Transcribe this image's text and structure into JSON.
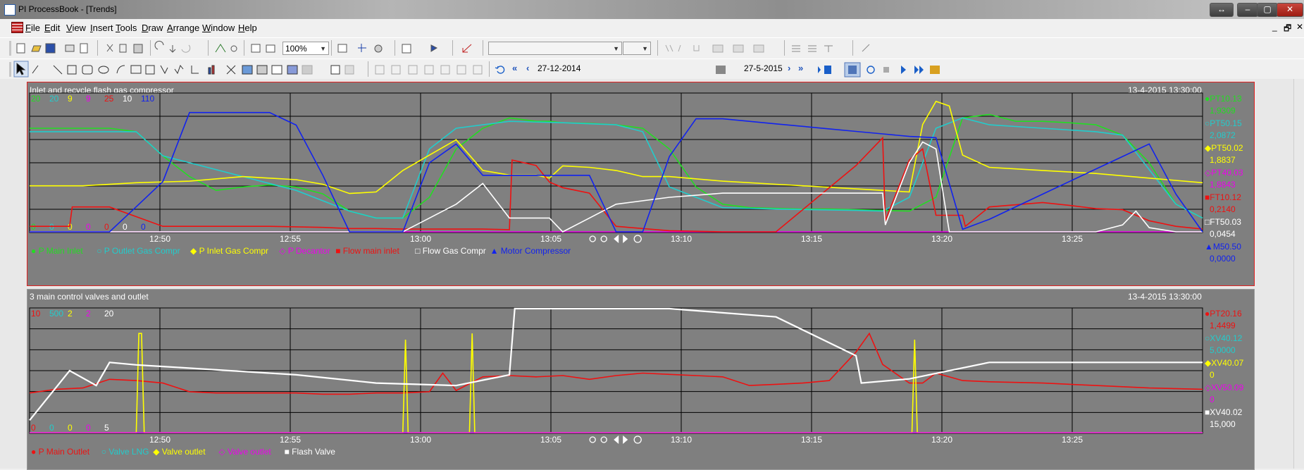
{
  "window": {
    "title": "PI ProcessBook - [Trends]"
  },
  "menu": [
    {
      "label": "File",
      "u": "F",
      "rest": "ile"
    },
    {
      "label": "Edit",
      "u": "E",
      "rest": "dit"
    },
    {
      "label": "View",
      "u": "V",
      "rest": "iew"
    },
    {
      "label": "Insert",
      "u": "I",
      "rest": "nsert"
    },
    {
      "label": "Tools",
      "u": "T",
      "rest": "ools"
    },
    {
      "label": "Draw",
      "u": "D",
      "rest": "raw"
    },
    {
      "label": "Arrange",
      "u": "A",
      "rest": "rrange"
    },
    {
      "label": "Window",
      "u": "W",
      "rest": "indow"
    },
    {
      "label": "Help",
      "u": "H",
      "rest": "elp"
    }
  ],
  "toolbar": {
    "zoom": "100%"
  },
  "timebar": {
    "start": "27-12-2014",
    "end": "27-5-2015"
  },
  "trends": [
    {
      "id": "top",
      "title": "Inlet and recycle flash gas compressor",
      "timestamp": "13-4-2015 13:30:00",
      "x_ticks": [
        "12:50",
        "12:55",
        "13:00",
        "13:05",
        "13:10",
        "13:15",
        "13:20",
        "13:25"
      ],
      "scale_top": [
        {
          "text": "20",
          "color": "#22dd22"
        },
        {
          "text": "20",
          "color": "#22cccc"
        },
        {
          "text": "9",
          "color": "#ffff00"
        },
        {
          "text": "9",
          "color": "#ee00ee"
        },
        {
          "text": "25",
          "color": "#ee1111"
        },
        {
          "text": "10",
          "color": "#ffffff"
        },
        {
          "text": "110",
          "color": "#1122ee"
        }
      ],
      "scale_bottom": [
        {
          "text": "0",
          "color": "#22dd22"
        },
        {
          "text": "0",
          "color": "#22cccc"
        },
        {
          "text": "0",
          "color": "#ffff00"
        },
        {
          "text": "0",
          "color": "#ee00ee"
        },
        {
          "text": "0",
          "color": "#ee1111"
        },
        {
          "text": "0",
          "color": "#ffffff"
        },
        {
          "text": "0",
          "color": "#1122ee"
        }
      ],
      "right_values": [
        {
          "tag": "PT10.13",
          "value": "1,9309",
          "color": "#22dd22",
          "marker": "●"
        },
        {
          "tag": "PT50.15",
          "value": "2,0872",
          "color": "#22cccc",
          "marker": "○"
        },
        {
          "tag": "PT50.02",
          "value": "1,8837",
          "color": "#ffff00",
          "marker": "◆"
        },
        {
          "tag": "PT40.03",
          "value": "1,8843",
          "color": "#ee00ee",
          "marker": "◇"
        },
        {
          "tag": "FT10.12",
          "value": "0,2140",
          "color": "#ee1111",
          "marker": "■"
        },
        {
          "tag": "FT50.03",
          "value": "0,0454",
          "color": "#ffffff",
          "marker": "□"
        },
        {
          "tag": "M50.50",
          "value": "0,0000",
          "color": "#1122ee",
          "marker": "▲"
        }
      ],
      "legend": [
        {
          "marker": "●",
          "text": "P Main Inlet",
          "color": "#22dd22"
        },
        {
          "marker": "○",
          "text": "P Outlet Gas Compr",
          "color": "#22cccc"
        },
        {
          "marker": "◆",
          "text": "P Inlet Gas Compr",
          "color": "#ffff00"
        },
        {
          "marker": "◇",
          "text": "P Decantor",
          "color": "#ee00ee"
        },
        {
          "marker": "■",
          "text": "Flow main inlet",
          "color": "#ee1111"
        },
        {
          "marker": "□",
          "text": "Flow Gas Compr",
          "color": "#ffffff"
        },
        {
          "marker": "▲",
          "text": "Motor Compressor",
          "color": "#1122ee"
        }
      ]
    },
    {
      "id": "bottom",
      "title": "3 main control valves and outlet",
      "timestamp": "13-4-2015 13:30:00",
      "x_ticks": [
        "12:50",
        "12:55",
        "13:00",
        "13:05",
        "13:10",
        "13:15",
        "13:20",
        "13:25"
      ],
      "scale_top": [
        {
          "text": "10",
          "color": "#ee1111"
        },
        {
          "text": "500",
          "color": "#22cccc"
        },
        {
          "text": "2",
          "color": "#ffff00"
        },
        {
          "text": "2",
          "color": "#ee00ee"
        },
        {
          "text": "20",
          "color": "#ffffff"
        }
      ],
      "scale_bottom": [
        {
          "text": "0",
          "color": "#ee1111"
        },
        {
          "text": "0",
          "color": "#22cccc"
        },
        {
          "text": "0",
          "color": "#ffff00"
        },
        {
          "text": "0",
          "color": "#ee00ee"
        },
        {
          "text": "5",
          "color": "#ffffff"
        }
      ],
      "right_values": [
        {
          "tag": "PT20.16",
          "value": "1,4499",
          "color": "#ee1111",
          "marker": "●"
        },
        {
          "tag": "XV40.12",
          "value": "5,0000",
          "color": "#22cccc",
          "marker": "○"
        },
        {
          "tag": "XV40.07",
          "value": "0",
          "color": "#ffff00",
          "marker": "◆"
        },
        {
          "tag": "XV50.09",
          "value": "0",
          "color": "#ee00ee",
          "marker": "◇"
        },
        {
          "tag": "XV40.02",
          "value": "15,000",
          "color": "#ffffff",
          "marker": "■"
        }
      ],
      "legend": [
        {
          "marker": "●",
          "text": "P Main Outlet",
          "color": "#ee1111"
        },
        {
          "marker": "○",
          "text": "Valve LNG",
          "color": "#22cccc"
        },
        {
          "marker": "◆",
          "text": "Valve outlet",
          "color": "#ffff00"
        },
        {
          "marker": "◇",
          "text": "Valve outlet",
          "color": "#ee00ee"
        },
        {
          "marker": "■",
          "text": "Flash Valve",
          "color": "#ffffff"
        }
      ]
    }
  ],
  "chart_data": [
    {
      "type": "line",
      "title": "Inlet and recycle flash gas compressor",
      "x_unit": "time (minutes from 12:46)",
      "xlim": [
        0,
        44
      ],
      "series": [
        {
          "name": "P Main Inlet",
          "color": "#22dd22",
          "ylim": [
            0,
            20
          ],
          "x": [
            0,
            3,
            4,
            5,
            6,
            7,
            8,
            9,
            10,
            11,
            12,
            13,
            14,
            15,
            16,
            17,
            18,
            19,
            19.5,
            20,
            21,
            22,
            23,
            24,
            25,
            26,
            27,
            28,
            29,
            30,
            31,
            32,
            33,
            34,
            35,
            36,
            37,
            38,
            39,
            40,
            41,
            42,
            43,
            44
          ],
          "y": [
            15,
            15,
            14.5,
            11,
            8,
            6,
            6.5,
            6.8,
            6.5,
            5.5,
            3,
            2,
            2,
            5,
            12,
            15,
            16.5,
            16,
            16,
            15.8,
            15.7,
            15.5,
            15,
            12,
            6.5,
            4,
            3.5,
            3.4,
            3.3,
            3.3,
            3.2,
            3.1,
            3,
            5,
            16.5,
            17,
            16,
            16,
            15.8,
            15.5,
            14,
            10,
            4,
            2
          ]
        },
        {
          "name": "P Outlet Gas Compr",
          "color": "#22cccc",
          "ylim": [
            0,
            20
          ],
          "x": [
            0,
            4,
            5,
            10,
            12,
            13,
            14,
            15,
            16,
            18,
            20,
            22,
            23,
            24,
            26,
            28,
            31,
            32,
            33,
            34,
            35,
            36,
            38,
            40,
            41,
            42,
            43,
            44
          ],
          "y": [
            14.5,
            14.5,
            11,
            6,
            3,
            2,
            2,
            12,
            15,
            16,
            15.8,
            15.5,
            14.5,
            6.5,
            3.5,
            3.3,
            3.1,
            3,
            5,
            15,
            16.5,
            15.5,
            15,
            14.5,
            14,
            9,
            4,
            2
          ]
        },
        {
          "name": "P Inlet Gas Compr",
          "color": "#ffff00",
          "ylim": [
            0,
            9
          ],
          "x": [
            0,
            2,
            4,
            6,
            8,
            10,
            11,
            12,
            13,
            14,
            15,
            16,
            17,
            18,
            19,
            19.5,
            20,
            21,
            22,
            23,
            24,
            26,
            28,
            30,
            32,
            33,
            33.5,
            34,
            34.5,
            35,
            36,
            37,
            38,
            40,
            42,
            44
          ],
          "y": [
            3,
            3,
            3.2,
            3.3,
            3.6,
            3.4,
            3.1,
            2.5,
            2.6,
            4,
            5,
            6,
            4,
            3.7,
            3.7,
            3.5,
            4.3,
            4.2,
            4.0,
            3.6,
            3.6,
            3.3,
            3.1,
            2.9,
            2.7,
            2.6,
            7,
            8.5,
            8.2,
            5,
            4.2,
            4.1,
            4,
            3.8,
            3.5,
            3.2
          ]
        },
        {
          "name": "P Decantor",
          "color": "#ee00ee",
          "ylim": [
            0,
            9
          ],
          "x": [
            0,
            44
          ],
          "y": [
            0,
            0
          ]
        },
        {
          "name": "Flow main inlet",
          "color": "#ee1111",
          "ylim": [
            0,
            25
          ],
          "x": [
            0,
            1.5,
            1.6,
            3,
            5,
            7,
            9,
            11,
            12,
            13,
            14,
            15,
            17,
            18,
            18.1,
            19,
            19.5,
            20,
            20.5,
            21,
            22,
            24,
            26,
            27,
            28,
            29,
            30,
            31,
            32,
            32.1,
            33,
            33.5,
            34,
            35,
            35.1,
            36,
            38,
            39,
            40,
            41,
            42,
            43,
            44
          ],
          "y": [
            1,
            1,
            4.5,
            4.5,
            1,
            1,
            1,
            0.8,
            0.6,
            0.6,
            0.5,
            0.5,
            0.5,
            0.4,
            13,
            12,
            9,
            8,
            7.5,
            7,
            1,
            0.2,
            0,
            0,
            0,
            4,
            8,
            12,
            17,
            2,
            13,
            15,
            3,
            3,
            1,
            4.5,
            5.3,
            4.8,
            4.2,
            4,
            2,
            1,
            0.5
          ]
        },
        {
          "name": "Flow Gas Compr",
          "color": "#ffffff",
          "ylim": [
            0,
            10
          ],
          "x": [
            0,
            2,
            4,
            5,
            6,
            7,
            8,
            9,
            10,
            11,
            11.5,
            12,
            13,
            14,
            15,
            16,
            17,
            18,
            18.5,
            19,
            19.5,
            20,
            21,
            22,
            24,
            26,
            28,
            30,
            31,
            32,
            32.1,
            33,
            33.5,
            34,
            34.5,
            35,
            36,
            38,
            40,
            41,
            41.5,
            42,
            43,
            44
          ],
          "y": [
            0,
            0,
            0,
            0,
            0,
            0,
            0,
            0,
            0,
            0,
            0,
            0,
            0,
            0,
            1,
            2,
            3.5,
            1,
            1,
            1,
            1,
            0,
            1,
            2,
            2.5,
            2.8,
            2.8,
            2.8,
            2.8,
            2.8,
            0.5,
            5,
            6.5,
            6,
            0,
            0,
            0,
            0,
            0,
            0.5,
            1.5,
            0.3,
            0,
            0
          ]
        },
        {
          "name": "Motor Compressor",
          "color": "#1122ee",
          "ylim": [
            0,
            110
          ],
          "x": [
            0,
            3,
            4,
            5,
            6,
            7,
            8,
            9,
            10,
            11,
            12,
            13,
            14,
            15,
            16,
            17,
            18,
            19,
            20,
            21,
            22,
            23,
            24,
            25,
            26,
            27,
            28,
            29,
            30,
            31,
            32,
            33,
            34,
            35,
            36,
            37,
            38,
            39,
            40,
            41,
            42,
            43,
            44
          ],
          "y": [
            0,
            0,
            20,
            40,
            95,
            95,
            95,
            95,
            85,
            45,
            0,
            0,
            0,
            55,
            70,
            45,
            45,
            45,
            45,
            45,
            0,
            0,
            60,
            90,
            90,
            88,
            86,
            84,
            82,
            80,
            78,
            76,
            75,
            2,
            10,
            20,
            30,
            40,
            50,
            60,
            70,
            30,
            0
          ]
        }
      ]
    },
    {
      "type": "line",
      "title": "3 main control valves and outlet",
      "x_unit": "time (minutes from 12:46)",
      "xlim": [
        0,
        44
      ],
      "series": [
        {
          "name": "P Main Outlet",
          "color": "#ee1111",
          "ylim": [
            0,
            10
          ],
          "x": [
            0,
            1,
            2,
            3,
            4,
            5,
            6,
            7,
            8,
            9,
            10,
            11,
            12,
            13,
            14,
            15,
            15.5,
            16,
            17,
            18,
            19,
            20,
            21,
            22,
            23,
            24,
            25,
            26,
            27,
            28,
            29,
            30,
            31,
            31.5,
            32,
            33,
            33.5,
            34,
            35,
            36,
            38,
            40,
            42,
            44
          ],
          "y": [
            3.2,
            3.5,
            3.6,
            4.3,
            4.2,
            4.0,
            3.3,
            3.2,
            3.2,
            3.2,
            3.2,
            3.1,
            3.1,
            3.2,
            3.2,
            3.3,
            4.8,
            3.4,
            4.5,
            4.6,
            4.5,
            4.6,
            4.3,
            4.6,
            4.8,
            4.7,
            4.6,
            4.5,
            3.8,
            3.9,
            4.0,
            4.2,
            6.5,
            8.0,
            5.5,
            4.0,
            4.0,
            4.8,
            4.2,
            4.1,
            4.0,
            3.8,
            3.6,
            3.5
          ]
        },
        {
          "name": "Valve LNG",
          "color": "#22cccc",
          "ylim": [
            0,
            500
          ],
          "x": [
            0,
            44
          ],
          "y": [
            0,
            0
          ]
        },
        {
          "name": "Valve outlet",
          "color": "#ffff00",
          "ylim": [
            0,
            2
          ],
          "x": [
            0,
            4.0,
            4.1,
            4.2,
            4.3,
            14,
            14.1,
            14.2,
            14.3,
            16.5,
            16.6,
            16.7,
            33.1,
            33.2,
            33.3,
            44
          ],
          "y": [
            0,
            0,
            1.6,
            1.6,
            0,
            0,
            1.5,
            0,
            0,
            0,
            1.6,
            0,
            0,
            1.5,
            0,
            0
          ]
        },
        {
          "name": "Valve outlet",
          "color": "#ee00ee",
          "ylim": [
            0,
            2
          ],
          "x": [
            0,
            44
          ],
          "y": [
            0,
            0
          ]
        },
        {
          "name": "Flash Valve",
          "color": "#ffffff",
          "ylim": [
            5,
            20
          ],
          "x": [
            0,
            1.5,
            2.5,
            3,
            4,
            5,
            10,
            13,
            16,
            18,
            18.2,
            20,
            24,
            28,
            31,
            31.2,
            33,
            36,
            40,
            44
          ],
          "y": [
            6.5,
            12.5,
            10.7,
            13.5,
            13.2,
            13,
            12,
            11,
            10.7,
            12,
            20,
            20,
            20,
            19,
            14.3,
            11,
            11.5,
            13.5,
            13.5,
            13.5
          ]
        }
      ]
    }
  ]
}
